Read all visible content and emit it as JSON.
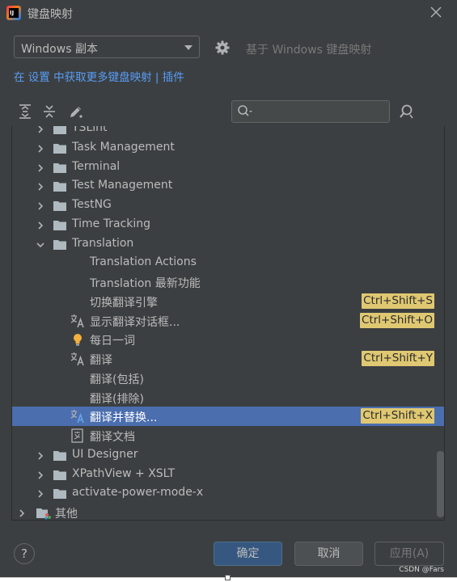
{
  "window": {
    "title": "键盘映射",
    "app_icon_text": "IJ"
  },
  "keymap": {
    "selected": "Windows 副本",
    "based_on": "基于 Windows 键盘映射"
  },
  "links": {
    "prefix": "在 设置 中获取更多键盘映射",
    "separator": " | ",
    "plugins": "插件"
  },
  "search": {
    "placeholder": ""
  },
  "tree": [
    {
      "label": "TSLint",
      "level": 1,
      "expanded": false,
      "type": "folder"
    },
    {
      "label": "Task Management",
      "level": 1,
      "expanded": false,
      "type": "folder"
    },
    {
      "label": "Terminal",
      "level": 1,
      "expanded": false,
      "type": "folder"
    },
    {
      "label": "Test Management",
      "level": 1,
      "expanded": false,
      "type": "folder"
    },
    {
      "label": "TestNG",
      "level": 1,
      "expanded": false,
      "type": "folder"
    },
    {
      "label": "Time Tracking",
      "level": 1,
      "expanded": false,
      "type": "folder"
    },
    {
      "label": "Translation",
      "level": 1,
      "expanded": true,
      "type": "folder"
    },
    {
      "label": "Translation Actions",
      "level": 2,
      "type": "action",
      "icon": "none"
    },
    {
      "label": "Translation 最新功能",
      "level": 2,
      "type": "action",
      "icon": "none"
    },
    {
      "label": "切换翻译引擎",
      "level": 2,
      "type": "action",
      "icon": "none",
      "shortcut": "Ctrl+Shift+S"
    },
    {
      "label": "显示翻译对话框...",
      "level": 2,
      "type": "action",
      "icon": "translate-icon",
      "shortcut": "Ctrl+Shift+O"
    },
    {
      "label": "每日一词",
      "level": 2,
      "type": "action",
      "icon": "lightbulb-icon"
    },
    {
      "label": "翻译",
      "level": 2,
      "type": "action",
      "icon": "translate-icon",
      "shortcut": "Ctrl+Shift+Y"
    },
    {
      "label": "翻译(包括)",
      "level": 2,
      "type": "action",
      "icon": "none"
    },
    {
      "label": "翻译(排除)",
      "level": 2,
      "type": "action",
      "icon": "none"
    },
    {
      "label": "翻译并替换...",
      "level": 2,
      "type": "action",
      "icon": "translate-replace-icon",
      "shortcut": "Ctrl+Shift+X",
      "selected": true
    },
    {
      "label": "翻译文档",
      "level": 2,
      "type": "action",
      "icon": "translate-doc-icon"
    },
    {
      "label": "UI Designer",
      "level": 1,
      "expanded": false,
      "type": "folder"
    },
    {
      "label": "XPathView + XSLT",
      "level": 1,
      "expanded": false,
      "type": "folder"
    },
    {
      "label": "activate-power-mode-x",
      "level": 1,
      "expanded": false,
      "type": "folder"
    },
    {
      "label": "其他",
      "level": 0,
      "expanded": false,
      "type": "other"
    }
  ],
  "buttons": {
    "help": "?",
    "ok": "确定",
    "cancel": "取消",
    "apply": "应用(A)"
  },
  "watermark": "CSDN @Fars",
  "colors": {
    "background": "#3c3f41",
    "selection": "#4b6eaf",
    "shortcut_bg": "#e0c872",
    "link": "#589df6",
    "ok_button": "#365880"
  }
}
